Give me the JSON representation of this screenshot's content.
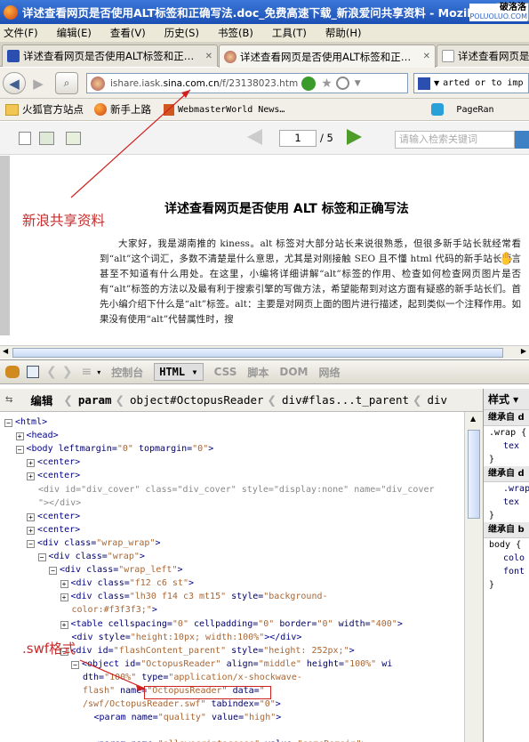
{
  "window": {
    "title": "详述查看网页是否使用ALT标签和正确写法.doc_免费高速下载_新浪爱问共享资料 - Mozilla"
  },
  "watermark": {
    "line1": "破洛洛",
    "line2": "POLUOLUO.COM"
  },
  "menu": [
    "文件(F)",
    "编辑(E)",
    "查看(V)",
    "历史(S)",
    "书签(B)",
    "工具(T)",
    "帮助(H)"
  ],
  "tabs": [
    {
      "title": "详述查看网页是否使用ALT标签和正…",
      "close": "✕"
    },
    {
      "title": "详述查看网页是否使用ALT标签和正…",
      "close": "✕"
    },
    {
      "title": "详述查看网页是否使用ALT标签和正…",
      "close": ""
    }
  ],
  "nav": {
    "url_pre": "ishare.iask.",
    "url_host": "sina.com.cn",
    "url_post": "/f/23138023.htm",
    "search_text": "arted or to imp"
  },
  "bookmarks": [
    {
      "label": "火狐官方站点"
    },
    {
      "label": "新手上路"
    },
    {
      "label": "WebmasterWorld News…"
    },
    {
      "label": "PageRan"
    }
  ],
  "viewer": {
    "page": "1",
    "total": "/ 5",
    "search_placeholder": "请输入检索关键词"
  },
  "document": {
    "title": "详述查看网页是否使用 ALT 标签和正确写法",
    "body": "大家好，我是湖南推的 kiness。alt 标签对大部分站长来说很熟悉，但很多新手站长就经常看到“alt”这个词汇，多数不清楚是什么意思，尤其是对刚接触 SEO 且不懂 html 代码的新手站长而言甚至不知道有什么用处。在这里，小编将详细讲解“alt”标签的作用、检查如何检查网页图片是否有“alt”标签的方法以及最有利于搜索引擎的写做方法，希望能帮到对这方面有疑惑的新手站长们。首先小编介绍下什么是“alt”标签。alt：主要是对网页上面的图片进行描述，起到类似一个注释作用。如果没有使用“alt”代替属性时，搜"
  },
  "annotations": {
    "share": "新浪共享资料",
    "swf": ".swf格式"
  },
  "firebug": {
    "tabs": [
      "控制台",
      "HTML ▾",
      "CSS",
      "脚本",
      "DOM",
      "网络"
    ],
    "edit": "编辑",
    "breadcrumbs": [
      "param",
      "object#OctopusReader",
      "div#flas...t_parent",
      "div"
    ],
    "style_tab": "样式 ▾",
    "style_lines": [
      "继承自 d",
      ".wrap {",
      "tex",
      "}",
      "继承自 d",
      ".wrap_w",
      "tex",
      "}",
      "继承自 b",
      "body {",
      "colo",
      "font",
      "}"
    ]
  },
  "tree": [
    {
      "indent": 0,
      "exp": "−",
      "parts": [
        [
          "tag",
          "<html>"
        ]
      ]
    },
    {
      "indent": 1,
      "exp": "+",
      "parts": [
        [
          "tag",
          "<head>"
        ]
      ]
    },
    {
      "indent": 1,
      "exp": "−",
      "parts": [
        [
          "tag",
          "<body "
        ],
        [
          "attr",
          "leftmargin="
        ],
        [
          "val",
          "\"0\""
        ],
        [
          "attr",
          " topmargin="
        ],
        [
          "val",
          "\"0\""
        ],
        [
          "tag",
          ">"
        ]
      ]
    },
    {
      "indent": 2,
      "exp": "+",
      "parts": [
        [
          "tag",
          "<center>"
        ]
      ]
    },
    {
      "indent": 2,
      "exp": "+",
      "parts": [
        [
          "tag",
          "<center>"
        ]
      ]
    },
    {
      "indent": 2,
      "exp": "",
      "parts": [
        [
          "grey",
          "<div id=\"div_cover\" class=\"div_cover\" style=\"display:none\" name=\"div_cover"
        ]
      ]
    },
    {
      "indent": 2,
      "exp": "",
      "parts": [
        [
          "grey",
          "\"></div>"
        ]
      ]
    },
    {
      "indent": 2,
      "exp": "+",
      "parts": [
        [
          "tag",
          "<center>"
        ]
      ]
    },
    {
      "indent": 2,
      "exp": "+",
      "parts": [
        [
          "tag",
          "<center>"
        ]
      ]
    },
    {
      "indent": 2,
      "exp": "−",
      "parts": [
        [
          "tag",
          "<div "
        ],
        [
          "attr",
          "class="
        ],
        [
          "val",
          "\"wrap_wrap\""
        ],
        [
          "tag",
          ">"
        ]
      ]
    },
    {
      "indent": 3,
      "exp": "−",
      "parts": [
        [
          "tag",
          "<div "
        ],
        [
          "attr",
          "class="
        ],
        [
          "val",
          "\"wrap\""
        ],
        [
          "tag",
          ">"
        ]
      ]
    },
    {
      "indent": 4,
      "exp": "−",
      "parts": [
        [
          "tag",
          "<div "
        ],
        [
          "attr",
          "class="
        ],
        [
          "val",
          "\"wrap_left\""
        ],
        [
          "tag",
          ">"
        ]
      ]
    },
    {
      "indent": 5,
      "exp": "+",
      "parts": [
        [
          "tag",
          "<div "
        ],
        [
          "attr",
          "class="
        ],
        [
          "val",
          "\"f12 c6 st\""
        ],
        [
          "tag",
          ">"
        ]
      ]
    },
    {
      "indent": 5,
      "exp": "+",
      "parts": [
        [
          "tag",
          "<div "
        ],
        [
          "attr",
          "class="
        ],
        [
          "val",
          "\"lh30 f14 c3 mt15\""
        ],
        [
          "attr",
          " style="
        ],
        [
          "val",
          "\"background-"
        ]
      ]
    },
    {
      "indent": 5,
      "exp": "",
      "parts": [
        [
          "val",
          "color:#f3f3f3;\""
        ],
        [
          "tag",
          ">"
        ]
      ]
    },
    {
      "indent": 5,
      "exp": "+",
      "parts": [
        [
          "tag",
          "<table "
        ],
        [
          "attr",
          "cellspacing="
        ],
        [
          "val",
          "\"0\""
        ],
        [
          "attr",
          " cellpadding="
        ],
        [
          "val",
          "\"0\""
        ],
        [
          "attr",
          " border="
        ],
        [
          "val",
          "\"0\""
        ],
        [
          "attr",
          " width="
        ],
        [
          "val",
          "\"400\""
        ],
        [
          "tag",
          ">"
        ]
      ]
    },
    {
      "indent": 5,
      "exp": "",
      "parts": [
        [
          "tag",
          "<div "
        ],
        [
          "attr",
          "style="
        ],
        [
          "val",
          "\"height:10px; width:100%\""
        ],
        [
          "tag",
          "></div>"
        ]
      ]
    },
    {
      "indent": 5,
      "exp": "−",
      "parts": [
        [
          "tag",
          "<div "
        ],
        [
          "attr",
          "id="
        ],
        [
          "val",
          "\"flashContent_parent\""
        ],
        [
          "attr",
          " style="
        ],
        [
          "val",
          "\"height: 252px;\""
        ],
        [
          "tag",
          ">"
        ]
      ]
    },
    {
      "indent": 6,
      "exp": "−",
      "parts": [
        [
          "tag",
          "<object "
        ],
        [
          "attr",
          "id="
        ],
        [
          "val",
          "\"OctopusReader\""
        ],
        [
          "attr",
          " align="
        ],
        [
          "val",
          "\"middle\""
        ],
        [
          "attr",
          " height="
        ],
        [
          "val",
          "\"100%\""
        ],
        [
          "attr",
          " wi"
        ]
      ]
    },
    {
      "indent": 6,
      "exp": "",
      "parts": [
        [
          "attr",
          "dth="
        ],
        [
          "val",
          "\"100%\""
        ],
        [
          "attr",
          " type="
        ],
        [
          "val",
          "\"application/x-shockwave-"
        ]
      ]
    },
    {
      "indent": 6,
      "exp": "",
      "parts": [
        [
          "val",
          "flash\""
        ],
        [
          "attr",
          " name="
        ],
        [
          "val",
          "\"OctopusReader\""
        ],
        [
          "attr",
          " data="
        ],
        [
          "val",
          "\""
        ]
      ]
    },
    {
      "indent": 6,
      "exp": "",
      "parts": [
        [
          "val",
          "/swf/OctopusReader.swf\""
        ],
        [
          "attr",
          " tabindex="
        ],
        [
          "val",
          "\"0\""
        ],
        [
          "tag",
          ">"
        ]
      ]
    },
    {
      "indent": 7,
      "exp": "",
      "parts": [
        [
          "tag",
          "<param "
        ],
        [
          "attr",
          "name="
        ],
        [
          "val",
          "\"quality\""
        ],
        [
          "attr",
          " value="
        ],
        [
          "val",
          "\"high\""
        ],
        [
          "tag",
          ">"
        ]
      ]
    },
    {
      "indent": 7,
      "exp": "",
      "parts": [
        [
          "tag",
          "<param "
        ],
        [
          "attr",
          "name="
        ],
        [
          "val",
          "\"bgcolor\""
        ],
        [
          "attr",
          " value="
        ],
        [
          "val",
          "\"#ffffff\""
        ],
        [
          "tag",
          ">"
        ]
      ]
    },
    {
      "indent": 7,
      "exp": "",
      "parts": [
        [
          "tag",
          "<param "
        ],
        [
          "attr",
          "name="
        ],
        [
          "val",
          "\"allowscriptaccess\""
        ],
        [
          "attr",
          " value="
        ],
        [
          "val",
          "\"sameDomain\""
        ],
        [
          "tag",
          ">"
        ]
      ]
    }
  ]
}
